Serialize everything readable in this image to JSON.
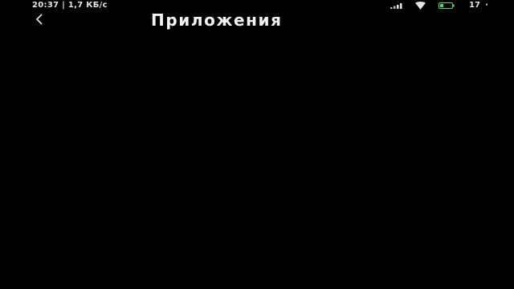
{
  "status_bar": {
    "time": "20:37",
    "separator": "|",
    "network_speed": "1,7 КБ/с",
    "battery_level": "17",
    "more_indicator": "·",
    "icons": [
      "signal-icon",
      "wifi-icon",
      "battery-icon"
    ]
  },
  "header": {
    "back_label": "<",
    "title": "Приложения"
  },
  "colors": {
    "background": "#000000",
    "text": "#f2f2f2",
    "battery_accent": "#4cd964"
  }
}
